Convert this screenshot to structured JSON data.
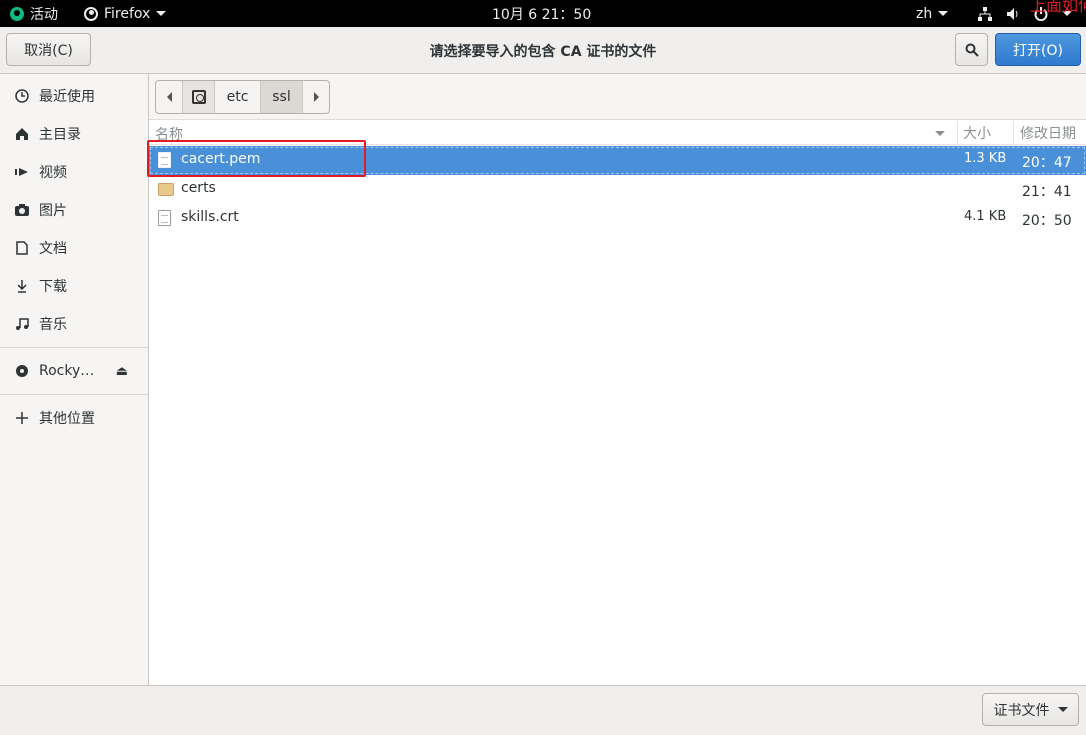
{
  "topbar": {
    "activities": "活动",
    "app_name": "Firefox",
    "clock": "10月 6  21：50",
    "lang": "zh",
    "overflow_text": "上面如何"
  },
  "dialog": {
    "title": "请选择要导入的包含 CA 证书的文件",
    "cancel_label": "取消(C)",
    "open_label": "打开(O)"
  },
  "sidebar": {
    "items": [
      {
        "label": "最近使用",
        "icon": "clock-icon"
      },
      {
        "label": "主目录",
        "icon": "home-icon"
      },
      {
        "label": "视频",
        "icon": "video-icon"
      },
      {
        "label": "图片",
        "icon": "camera-icon"
      },
      {
        "label": "文档",
        "icon": "document-icon"
      },
      {
        "label": "下载",
        "icon": "download-icon"
      },
      {
        "label": "音乐",
        "icon": "music-icon"
      }
    ],
    "device": {
      "label": "Rocky…",
      "icon": "disc-icon"
    },
    "other": {
      "label": "其他位置",
      "icon": "plus-icon"
    }
  },
  "pathbar": {
    "segments": [
      "etc",
      "ssl"
    ]
  },
  "columns": {
    "name": "名称",
    "size": "大小",
    "modified": "修改日期"
  },
  "files": [
    {
      "name": "cacert.pem",
      "size": "1.3 KB",
      "modified": "20：47",
      "type": "file",
      "selected": true
    },
    {
      "name": "certs",
      "size": "",
      "modified": "21：41",
      "type": "folder",
      "selected": false
    },
    {
      "name": "skills.crt",
      "size": "4.1 KB",
      "modified": "20：50",
      "type": "file",
      "selected": false
    }
  ],
  "filter": {
    "label": "证书文件"
  },
  "colors": {
    "accent": "#4a90d9",
    "highlight_box": "#e01b24"
  }
}
